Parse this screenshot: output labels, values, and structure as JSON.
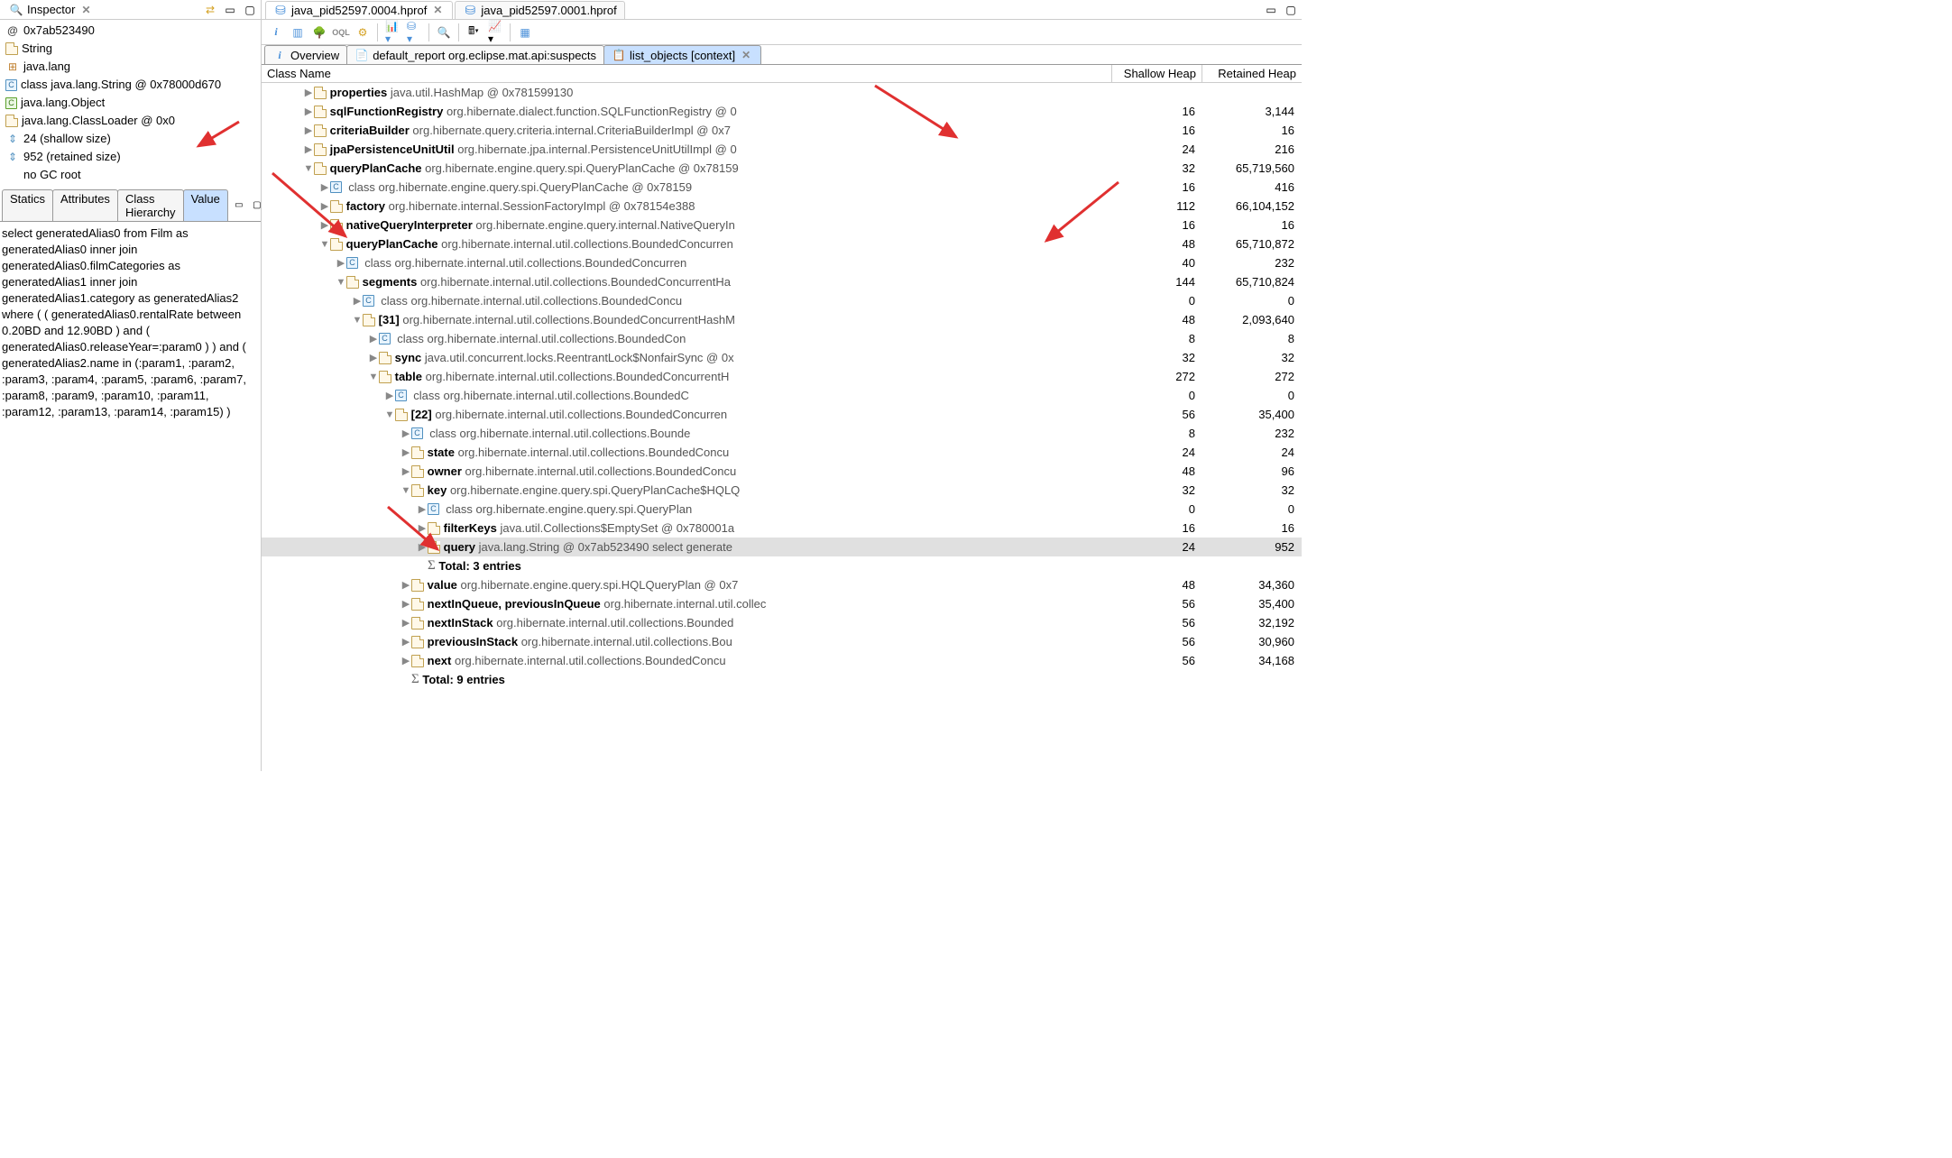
{
  "inspector": {
    "title": "Inspector",
    "rows": [
      {
        "icon": "at",
        "text": "0x7ab523490"
      },
      {
        "icon": "file",
        "text": "String"
      },
      {
        "icon": "pkg",
        "text": "java.lang"
      },
      {
        "icon": "class",
        "text": "class java.lang.String @ 0x78000d670"
      },
      {
        "icon": "classg",
        "text": "java.lang.Object"
      },
      {
        "icon": "file",
        "text": "java.lang.ClassLoader @ 0x0"
      },
      {
        "icon": "size",
        "text": "24 (shallow size)"
      },
      {
        "icon": "size",
        "text": "952 (retained size)"
      },
      {
        "icon": "blank",
        "text": "no GC root"
      }
    ],
    "tabs": [
      "Statics",
      "Attributes",
      "Class Hierarchy",
      "Value"
    ],
    "active_tab": "Value",
    "value_text": "select generatedAlias0 from Film as generatedAlias0 inner join generatedAlias0.filmCategories as generatedAlias1 inner join generatedAlias1.category as generatedAlias2 where ( ( generatedAlias0.rentalRate between 0.20BD and 12.90BD ) and ( generatedAlias0.releaseYear=:param0 ) ) and ( generatedAlias2.name in (:param1, :param2, :param3, :param4, :param5, :param6, :param7, :param8, :param9, :param10, :param11, :param12, :param13, :param14, :param15) )"
  },
  "editor_tabs": [
    {
      "label": "java_pid52597.0004.hprof",
      "active": true
    },
    {
      "label": "java_pid52597.0001.hprof",
      "active": false
    }
  ],
  "sub_tabs": [
    {
      "icon": "i",
      "label": "Overview",
      "active": false
    },
    {
      "icon": "report",
      "label": "default_report  org.eclipse.mat.api:suspects",
      "active": false
    },
    {
      "icon": "list",
      "label": "list_objects  [context]",
      "active": true
    }
  ],
  "columns": {
    "name": "Class Name",
    "shallow": "Shallow Heap",
    "retained": "Retained Heap"
  },
  "tree_rows": [
    {
      "depth": 2,
      "arrow": "▶",
      "icon": "file",
      "bold": "properties",
      "gray": "java.util.HashMap @ 0x781599130",
      "shallow": "",
      "retained": "",
      "cut": true
    },
    {
      "depth": 2,
      "arrow": "▶",
      "icon": "file",
      "bold": "sqlFunctionRegistry",
      "gray": "org.hibernate.dialect.function.SQLFunctionRegistry @ 0",
      "shallow": "16",
      "retained": "3,144"
    },
    {
      "depth": 2,
      "arrow": "▶",
      "icon": "file",
      "bold": "criteriaBuilder",
      "gray": "org.hibernate.query.criteria.internal.CriteriaBuilderImpl @ 0x7",
      "shallow": "16",
      "retained": "16"
    },
    {
      "depth": 2,
      "arrow": "▶",
      "icon": "file",
      "bold": "jpaPersistenceUnitUtil",
      "gray": "org.hibernate.jpa.internal.PersistenceUnitUtilImpl @ 0",
      "shallow": "24",
      "retained": "216"
    },
    {
      "depth": 2,
      "arrow": "▼",
      "icon": "file",
      "bold": "queryPlanCache",
      "gray": "org.hibernate.engine.query.spi.QueryPlanCache @ 0x78159",
      "shallow": "32",
      "retained": "65,719,560"
    },
    {
      "depth": 3,
      "arrow": "▶",
      "icon": "class",
      "bold": "<class>",
      "gray": "class org.hibernate.engine.query.spi.QueryPlanCache @ 0x78159",
      "shallow": "16",
      "retained": "416"
    },
    {
      "depth": 3,
      "arrow": "▶",
      "icon": "file",
      "bold": "factory",
      "gray": "org.hibernate.internal.SessionFactoryImpl @ 0x78154e388",
      "shallow": "112",
      "retained": "66,104,152"
    },
    {
      "depth": 3,
      "arrow": "▶",
      "icon": "file",
      "bold": "nativeQueryInterpreter",
      "gray": "org.hibernate.engine.query.internal.NativeQueryIn",
      "shallow": "16",
      "retained": "16"
    },
    {
      "depth": 3,
      "arrow": "▼",
      "icon": "file",
      "bold": "queryPlanCache",
      "gray": "org.hibernate.internal.util.collections.BoundedConcurren",
      "shallow": "48",
      "retained": "65,710,872"
    },
    {
      "depth": 4,
      "arrow": "▶",
      "icon": "class",
      "bold": "<class>",
      "gray": "class org.hibernate.internal.util.collections.BoundedConcurren",
      "shallow": "40",
      "retained": "232"
    },
    {
      "depth": 4,
      "arrow": "▼",
      "icon": "file",
      "bold": "segments",
      "gray": "org.hibernate.internal.util.collections.BoundedConcurrentHa",
      "shallow": "144",
      "retained": "65,710,824"
    },
    {
      "depth": 5,
      "arrow": "▶",
      "icon": "class",
      "bold": "<class>",
      "gray": "class org.hibernate.internal.util.collections.BoundedConcu",
      "shallow": "0",
      "retained": "0"
    },
    {
      "depth": 5,
      "arrow": "▼",
      "icon": "file",
      "bold": "[31]",
      "gray": "org.hibernate.internal.util.collections.BoundedConcurrentHashM",
      "shallow": "48",
      "retained": "2,093,640"
    },
    {
      "depth": 6,
      "arrow": "▶",
      "icon": "class",
      "bold": "<class>",
      "gray": "class org.hibernate.internal.util.collections.BoundedCon",
      "shallow": "8",
      "retained": "8"
    },
    {
      "depth": 6,
      "arrow": "▶",
      "icon": "file",
      "bold": "sync",
      "gray": "java.util.concurrent.locks.ReentrantLock$NonfairSync @ 0x",
      "shallow": "32",
      "retained": "32"
    },
    {
      "depth": 6,
      "arrow": "▼",
      "icon": "file",
      "bold": "table",
      "gray": "org.hibernate.internal.util.collections.BoundedConcurrentH",
      "shallow": "272",
      "retained": "272"
    },
    {
      "depth": 7,
      "arrow": "▶",
      "icon": "class",
      "bold": "<class>",
      "gray": "class org.hibernate.internal.util.collections.BoundedC",
      "shallow": "0",
      "retained": "0"
    },
    {
      "depth": 7,
      "arrow": "▼",
      "icon": "file",
      "bold": "[22]",
      "gray": "org.hibernate.internal.util.collections.BoundedConcurren",
      "shallow": "56",
      "retained": "35,400"
    },
    {
      "depth": 8,
      "arrow": "▶",
      "icon": "class",
      "bold": "<class>",
      "gray": "class org.hibernate.internal.util.collections.Bounde",
      "shallow": "8",
      "retained": "232"
    },
    {
      "depth": 8,
      "arrow": "▶",
      "icon": "file",
      "bold": "state",
      "gray": "org.hibernate.internal.util.collections.BoundedConcu",
      "shallow": "24",
      "retained": "24"
    },
    {
      "depth": 8,
      "arrow": "▶",
      "icon": "file",
      "bold": "owner",
      "gray": "org.hibernate.internal.util.collections.BoundedConcu",
      "shallow": "48",
      "retained": "96"
    },
    {
      "depth": 8,
      "arrow": "▼",
      "icon": "file",
      "bold": "key",
      "gray": "org.hibernate.engine.query.spi.QueryPlanCache$HQLQ",
      "shallow": "32",
      "retained": "32"
    },
    {
      "depth": 9,
      "arrow": "▶",
      "icon": "class",
      "bold": "<class>",
      "gray": "class org.hibernate.engine.query.spi.QueryPlan",
      "shallow": "0",
      "retained": "0"
    },
    {
      "depth": 9,
      "arrow": "▶",
      "icon": "file",
      "bold": "filterKeys",
      "gray": "java.util.Collections$EmptySet @ 0x780001a",
      "shallow": "16",
      "retained": "16"
    },
    {
      "depth": 9,
      "arrow": "▶",
      "icon": "file",
      "bold": "query",
      "gray": "java.lang.String @ 0x7ab523490  select generate",
      "shallow": "24",
      "retained": "952",
      "selected": true
    },
    {
      "depth": 9,
      "arrow": "",
      "icon": "sigma",
      "bold": "Total: 3 entries",
      "gray": "",
      "shallow": "",
      "retained": ""
    },
    {
      "depth": 8,
      "arrow": "▶",
      "icon": "file",
      "bold": "value",
      "gray": "org.hibernate.engine.query.spi.HQLQueryPlan @ 0x7",
      "shallow": "48",
      "retained": "34,360"
    },
    {
      "depth": 8,
      "arrow": "▶",
      "icon": "file",
      "bold": "nextInQueue, previousInQueue",
      "gray": "org.hibernate.internal.util.collec",
      "shallow": "56",
      "retained": "35,400"
    },
    {
      "depth": 8,
      "arrow": "▶",
      "icon": "file",
      "bold": "nextInStack",
      "gray": "org.hibernate.internal.util.collections.Bounded",
      "shallow": "56",
      "retained": "32,192"
    },
    {
      "depth": 8,
      "arrow": "▶",
      "icon": "file",
      "bold": "previousInStack",
      "gray": "org.hibernate.internal.util.collections.Bou",
      "shallow": "56",
      "retained": "30,960"
    },
    {
      "depth": 8,
      "arrow": "▶",
      "icon": "file",
      "bold": "next",
      "gray": "org.hibernate.internal.util.collections.BoundedConcu",
      "shallow": "56",
      "retained": "34,168"
    },
    {
      "depth": 8,
      "arrow": "",
      "icon": "sigma",
      "bold": "Total: 9 entries",
      "gray": "",
      "shallow": "",
      "retained": ""
    }
  ]
}
